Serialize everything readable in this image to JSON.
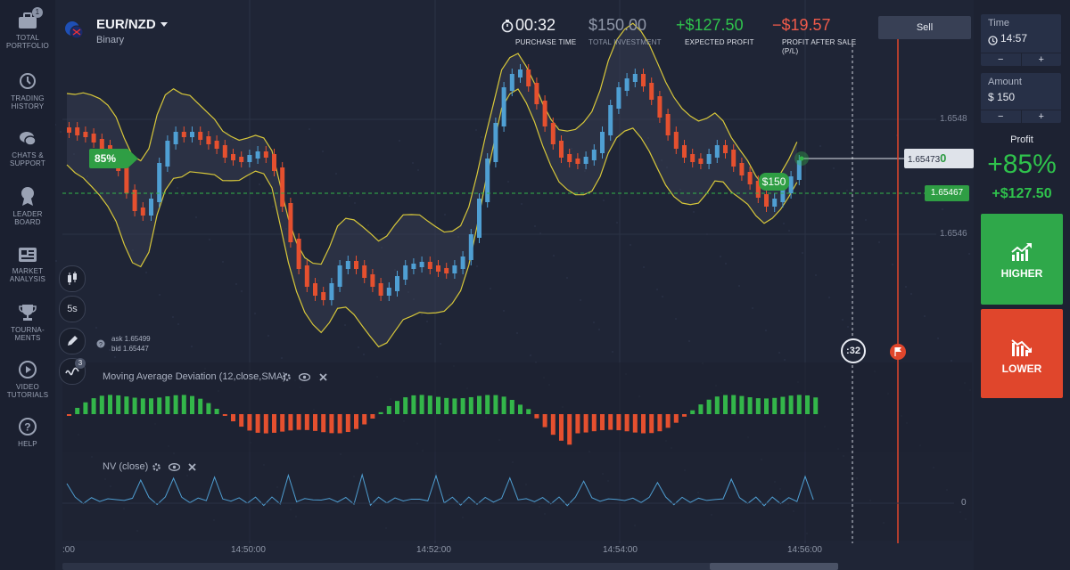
{
  "sidebar": {
    "items": [
      {
        "id": "portfolio",
        "icon": "briefcase-icon",
        "label1": "TOTAL",
        "label2": "PORTFOLIO",
        "badge": "1"
      },
      {
        "id": "history",
        "icon": "clock-history-icon",
        "label1": "TRADING",
        "label2": "HISTORY"
      },
      {
        "id": "chats",
        "icon": "chat-icon",
        "label1": "CHATS &",
        "label2": "SUPPORT"
      },
      {
        "id": "leaderboard",
        "icon": "medal-icon",
        "label1": "LEADER",
        "label2": "BOARD"
      },
      {
        "id": "market",
        "icon": "newspaper-icon",
        "label1": "MARKET",
        "label2": "ANALYSIS"
      },
      {
        "id": "tournaments",
        "icon": "trophy-icon",
        "label1": "TOURNA-",
        "label2": "MENTS"
      },
      {
        "id": "video",
        "icon": "play-icon",
        "label1": "VIDEO",
        "label2": "TUTORIALS"
      },
      {
        "id": "help",
        "icon": "help-icon",
        "label1": "HELP",
        "label2": ""
      }
    ]
  },
  "asset": {
    "name": "EUR/NZD",
    "type": "Binary",
    "icon": "eu-nz-flag-icon"
  },
  "header": {
    "timer": "00:32",
    "timer_label": "PURCHASE TIME",
    "investment": "$150.00",
    "investment_label": "TOTAL INVESTMENT",
    "profit": "+$127.50",
    "profit_label": "EXPECTED PROFIT",
    "pl": "−$19.57",
    "pl_label1": "PROFIT AFTER SALE",
    "pl_label2": "(P/L)",
    "sell": "Sell"
  },
  "chart": {
    "payout_badge": "85%",
    "ask": "ask 1.65499",
    "bid": "bid 1.65447",
    "price_axis": [
      "1.6548",
      "1.6546"
    ],
    "current_price_main": "1.65473",
    "current_price_end": "0",
    "strike_price": "1.65467",
    "trade_badge": "$150",
    "countdown": ":32",
    "time_axis": [
      "14:50:00",
      "14:52:00",
      "14:54:00",
      "14:56:00"
    ],
    "time_axis_first": ":00",
    "indicator1": "Moving Average Deviation (12,close,SMA)",
    "indicator2": "NV (close)",
    "nv_zero": "0",
    "tools": [
      "candles-icon",
      "5s",
      "pencil-icon",
      "indicators-icon"
    ],
    "tools_count": "3",
    "colors": {
      "up": "#4f9fd3",
      "down": "#e5502f",
      "band": "#d8c83a",
      "green": "#33b64a"
    }
  },
  "right": {
    "time_label": "Time",
    "time_value": "14:57",
    "amount_label": "Amount",
    "amount_value": "$ 150",
    "minus": "−",
    "plus": "+",
    "profit_label": "Profit",
    "profit_pct": "+85%",
    "profit_value": "+$127.50",
    "higher": "HIGHER",
    "lower": "LOWER"
  }
}
